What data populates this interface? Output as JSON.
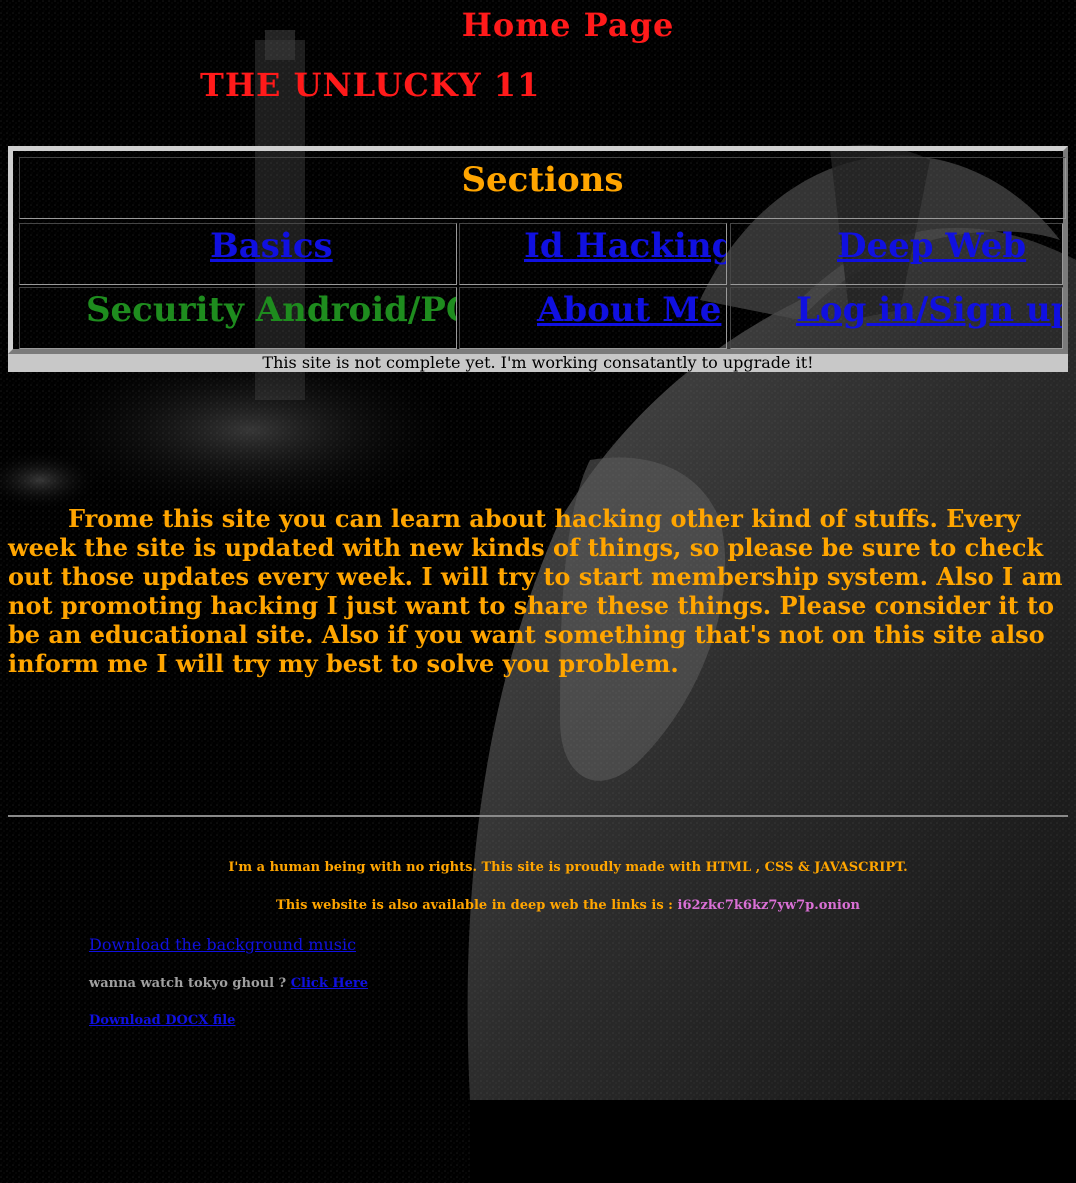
{
  "header": {
    "page_title": "Home Page",
    "site_name": "THE UNLUCKY 11"
  },
  "sections": {
    "heading": "Sections",
    "row1": {
      "basics": "Basics",
      "id_hacking": "Id Hacking",
      "deep_web": "Deep Web"
    },
    "row2": {
      "security": "Security Android/PC",
      "about_me": "About Me",
      "login": "Log in/Sign up"
    }
  },
  "notice": "This site is not complete yet. I'm working consatantly to upgrade it!",
  "intro": "Frome this site you can learn about hacking other kind of stuffs. Every week the site is updated with new kinds of things, so please be sure to check out those updates every week. I will try to start membership system. Also I am not promoting hacking I just want to share these things. Please consider it to be an educational site. Also if you want something that's not on this site also inform me I will try my best to solve you problem.",
  "footer": {
    "credit": "I'm a human being with no rights. This site is proudly made with HTML , CSS & JAVASCRIPT.",
    "deep_web_prefix": "This website is also available in deep web the links is : ",
    "onion_link": "i62zkc7k6kz7yw7p.onion",
    "music_link": "Download the background music",
    "tokyo_prefix": "wanna watch tokyo ghoul ? ",
    "tokyo_link": "Click Here",
    "docx_link": "Download DOCX file"
  },
  "colors": {
    "title_red": "#ff1a1a",
    "accent_orange": "#ffa500",
    "link_blue": "#1010e0",
    "static_green": "#1e8c1e",
    "onion_pink": "#da70d6"
  }
}
